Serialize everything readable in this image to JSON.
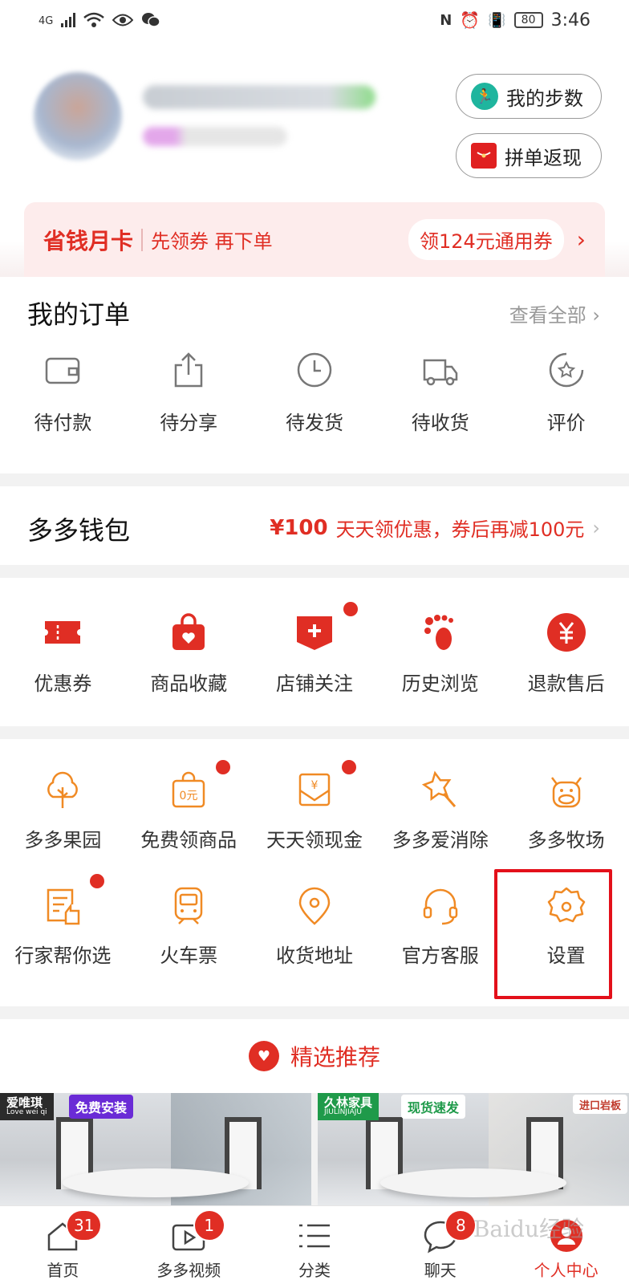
{
  "status_bar": {
    "network": "4G",
    "battery": "80",
    "time": "3:46"
  },
  "header": {
    "steps_button": "我的步数",
    "cashback_button": "拼单返现"
  },
  "card": {
    "title": "省钱月卡",
    "subtitle": "先领券 再下单",
    "coupon": "领124元通用券",
    "arrow": "›"
  },
  "orders": {
    "title": "我的订单",
    "view_all": "查看全部 ›",
    "items": [
      {
        "label": "待付款",
        "icon": "wallet-icon"
      },
      {
        "label": "待分享",
        "icon": "share-icon"
      },
      {
        "label": "待发货",
        "icon": "clock-icon"
      },
      {
        "label": "待收货",
        "icon": "truck-icon"
      },
      {
        "label": "评价",
        "icon": "star-review-icon"
      }
    ]
  },
  "wallet": {
    "title": "多多钱包",
    "amount": "¥100",
    "promo": "天天领优惠，券后再减100元",
    "chevron": "›"
  },
  "services": {
    "items": [
      {
        "label": "优惠券",
        "icon": "coupon-icon"
      },
      {
        "label": "商品收藏",
        "icon": "bag-heart-icon"
      },
      {
        "label": "店铺关注",
        "icon": "store-plus-icon",
        "dot": true
      },
      {
        "label": "历史浏览",
        "icon": "footprint-icon"
      },
      {
        "label": "退款售后",
        "icon": "refund-icon"
      }
    ]
  },
  "tools": {
    "items": [
      {
        "label": "多多果园",
        "icon": "tree-icon"
      },
      {
        "label": "免费领商品",
        "icon": "free-bag-icon",
        "dot": true,
        "icon_text": "0元"
      },
      {
        "label": "天天领现金",
        "icon": "cash-envelope-icon",
        "dot": true,
        "icon_text": "¥"
      },
      {
        "label": "多多爱消除",
        "icon": "star-wand-icon"
      },
      {
        "label": "多多牧场",
        "icon": "cow-icon"
      },
      {
        "label": "行家帮你选",
        "icon": "thumb-doc-icon",
        "dot": true
      },
      {
        "label": "火车票",
        "icon": "train-icon"
      },
      {
        "label": "收货地址",
        "icon": "location-icon"
      },
      {
        "label": "官方客服",
        "icon": "headset-icon"
      },
      {
        "label": "设置",
        "icon": "gear-icon"
      }
    ]
  },
  "recommend": {
    "title": "精选推荐"
  },
  "products": [
    {
      "brand": "爱唯琪",
      "brand_sub": "Love wei qi",
      "tag": "免费安装"
    },
    {
      "brand": "久林家具",
      "brand_sub": "JIULINJIAJU",
      "tag": "现货速发",
      "corner": "进口岩板"
    }
  ],
  "tabbar": {
    "items": [
      {
        "label": "首页",
        "badge": "31",
        "icon": "home-icon"
      },
      {
        "label": "多多视频",
        "badge": "1",
        "icon": "video-icon"
      },
      {
        "label": "分类",
        "badge": "",
        "icon": "list-icon"
      },
      {
        "label": "聊天",
        "badge": "8",
        "icon": "chat-icon"
      },
      {
        "label": "个人中心",
        "badge": "",
        "icon": "profile-icon",
        "active": true
      }
    ]
  },
  "watermark": "Baidu经验",
  "colors": {
    "brand_red": "#e02e24",
    "tool_orange": "#f08a24",
    "highlight": "#e3101a"
  }
}
